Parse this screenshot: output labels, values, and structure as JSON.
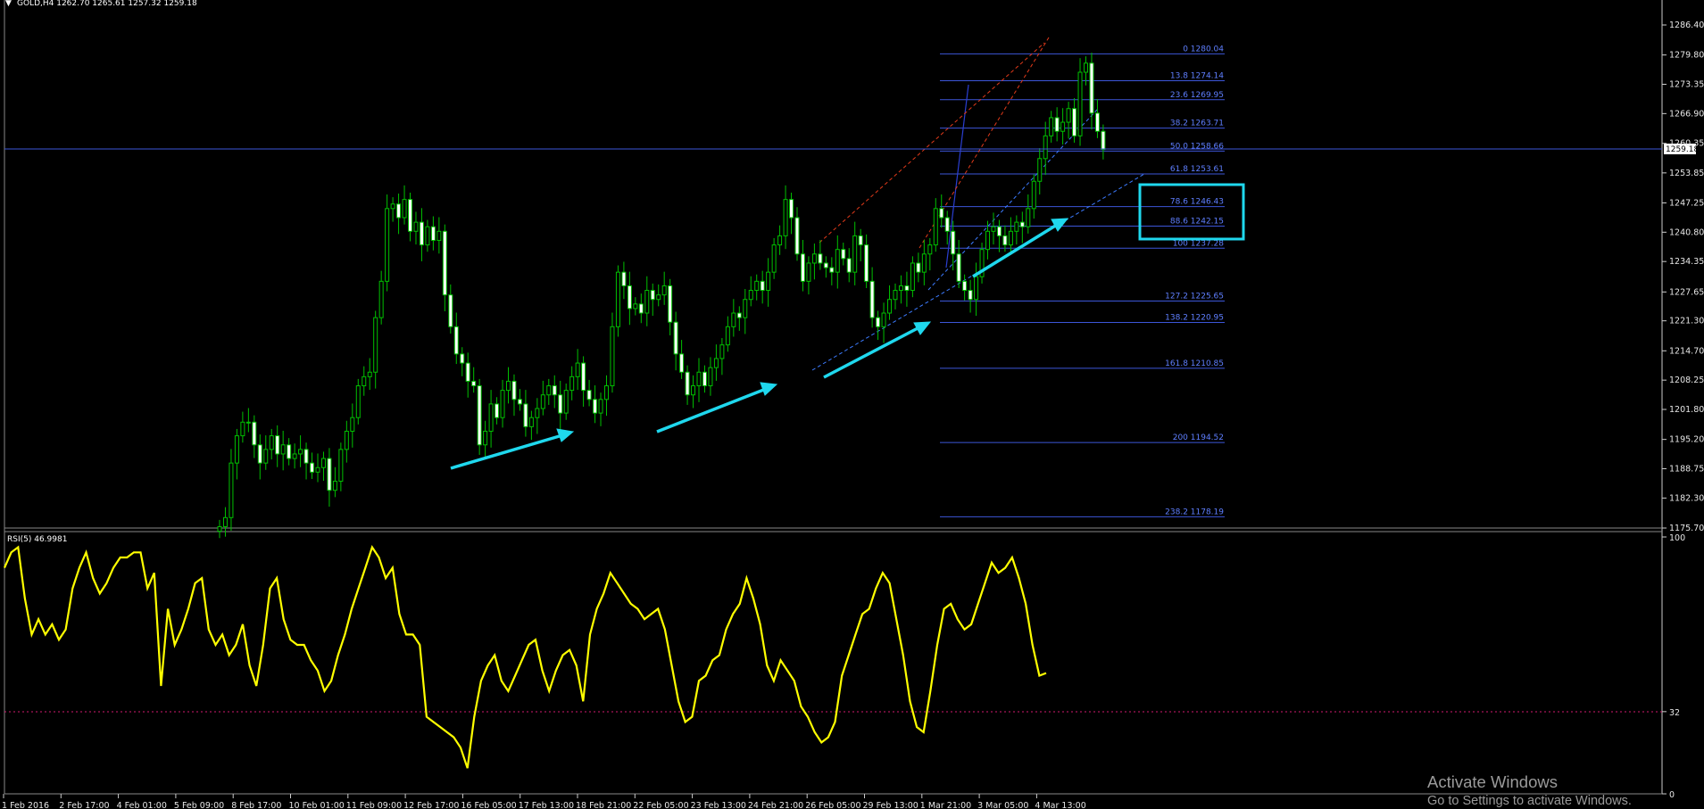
{
  "symbol_header": {
    "marker": "▼",
    "text": "GOLD,H4  1262.70 1265.61 1257.32 1259.18"
  },
  "rsi_header": "RSI(5) 46.9981",
  "current_price_label": "1259.18",
  "price_axis_labels": [
    "1286.40",
    "1279.80",
    "1273.35",
    "1266.90",
    "1260.35",
    "1253.85",
    "1247.25",
    "1240.80",
    "1234.35",
    "1227.65",
    "1221.30",
    "1214.70",
    "1208.25",
    "1201.80",
    "1195.20",
    "1188.75",
    "1182.30",
    "1175.70"
  ],
  "rsi_axis_labels": [
    "100",
    "32",
    "0"
  ],
  "time_axis_labels": [
    "1 Feb 2016",
    "2 Feb 17:00",
    "4 Feb 01:00",
    "5 Feb 09:00",
    "8 Feb 17:00",
    "10 Feb 01:00",
    "11 Feb 09:00",
    "12 Feb 17:00",
    "16 Feb 05:00",
    "17 Feb 13:00",
    "18 Feb 21:00",
    "22 Feb 05:00",
    "23 Feb 13:00",
    "24 Feb 21:00",
    "26 Feb 05:00",
    "29 Feb 13:00",
    "1 Mar 21:00",
    "3 Mar 05:00",
    "4 Mar 13:00"
  ],
  "fib_levels": [
    {
      "label": "0 1280.04",
      "price": 1280.04
    },
    {
      "label": "13.8 1274.14",
      "price": 1274.14
    },
    {
      "label": "23.6 1269.95",
      "price": 1269.95
    },
    {
      "label": "38.2 1263.71",
      "price": 1263.71
    },
    {
      "label": "50.0 1258.66",
      "price": 1258.66
    },
    {
      "label": "61.8 1253.61",
      "price": 1253.61
    },
    {
      "label": "78.6 1246.43",
      "price": 1246.43
    },
    {
      "label": "88.6 1242.15",
      "price": 1242.15
    },
    {
      "label": "100 1237.28",
      "price": 1237.28
    },
    {
      "label": "127.2 1225.65",
      "price": 1225.65
    },
    {
      "label": "138.2 1220.95",
      "price": 1220.95
    },
    {
      "label": "161.8 1210.85",
      "price": 1210.85
    },
    {
      "label": "200 1194.52",
      "price": 1194.52
    },
    {
      "label": "238.2 1178.19",
      "price": 1178.19
    }
  ],
  "watermark": {
    "title": "Activate Windows",
    "subtitle": "Go to Settings to activate Windows."
  },
  "colors": {
    "background": "#000000",
    "candle": "#00c000",
    "candle_bull_body": "#000000",
    "candle_bear_body": "#ffffff",
    "rsi_line": "#ffff00",
    "fib_line": "#3c56d8",
    "arrow": "#1fd8ee",
    "highlight_box": "#1fd8ee",
    "channel_blue": "#3c7bff",
    "channel_red": "#e23a1a",
    "rsi_level_line": "#d11a6e"
  },
  "chart_data": [
    {
      "type": "candlestick",
      "title": "GOLD,H4",
      "ohlc_last": {
        "open": 1262.7,
        "high": 1265.61,
        "low": 1257.32,
        "close": 1259.18
      },
      "ylim": [
        1175.7,
        1286.4
      ],
      "x_range": [
        "1 Feb 2016",
        "4 Mar 2016 13:00"
      ],
      "close": [
        1176,
        1178,
        1190,
        1196,
        1199,
        1199,
        1194,
        1190,
        1193,
        1196,
        1192,
        1194,
        1191,
        1192,
        1193,
        1190,
        1188,
        1189,
        1191,
        1184,
        1186,
        1193,
        1197,
        1200,
        1207,
        1209,
        1210,
        1222,
        1230,
        1246,
        1247,
        1244,
        1248,
        1241,
        1243,
        1238,
        1242,
        1239,
        1241,
        1227,
        1220,
        1214,
        1212,
        1208,
        1207,
        1194,
        1197,
        1203,
        1200,
        1206,
        1208,
        1204,
        1203,
        1198,
        1200,
        1202,
        1205,
        1207,
        1205,
        1201,
        1206,
        1209,
        1212,
        1206,
        1204,
        1201,
        1204,
        1207,
        1220,
        1232,
        1229,
        1224,
        1225,
        1223,
        1228,
        1226,
        1227,
        1229,
        1221,
        1214,
        1210,
        1205,
        1207,
        1210,
        1207,
        1211,
        1213,
        1216,
        1220,
        1223,
        1222,
        1226,
        1228,
        1230,
        1228,
        1232,
        1238,
        1240,
        1248,
        1244,
        1236,
        1230,
        1234,
        1236,
        1234,
        1233,
        1232,
        1237,
        1235,
        1232,
        1240,
        1238,
        1230,
        1222,
        1220,
        1223,
        1226,
        1228,
        1229,
        1228,
        1234,
        1232,
        1236,
        1238,
        1246,
        1244,
        1241,
        1236,
        1230,
        1228,
        1226,
        1231,
        1237,
        1241,
        1242,
        1240,
        1238,
        1241,
        1243,
        1242,
        1246,
        1252,
        1257,
        1262,
        1266,
        1263,
        1265,
        1268,
        1262,
        1276,
        1278,
        1267,
        1263,
        1259
      ]
    },
    {
      "type": "line",
      "title": "RSI(5) 46.9981",
      "ylim": [
        0,
        100
      ],
      "levels": [
        32
      ],
      "series": [
        {
          "name": "RSI(5)",
          "values": [
            88,
            94,
            96,
            76,
            62,
            68,
            62,
            66,
            60,
            64,
            80,
            88,
            94,
            84,
            78,
            82,
            88,
            92,
            92,
            94,
            94,
            80,
            86,
            42,
            72,
            58,
            64,
            72,
            82,
            84,
            64,
            58,
            62,
            54,
            58,
            66,
            50,
            42,
            58,
            80,
            84,
            68,
            60,
            58,
            58,
            52,
            48,
            40,
            44,
            54,
            62,
            72,
            80,
            88,
            96,
            92,
            84,
            88,
            70,
            62,
            62,
            58,
            30,
            28,
            26,
            24,
            22,
            18,
            10,
            30,
            44,
            50,
            54,
            44,
            40,
            46,
            52,
            58,
            60,
            48,
            40,
            48,
            54,
            56,
            50,
            36,
            62,
            72,
            78,
            86,
            82,
            78,
            74,
            72,
            68,
            70,
            72,
            64,
            50,
            36,
            28,
            30,
            44,
            46,
            52,
            54,
            64,
            70,
            74,
            84,
            76,
            66,
            50,
            44,
            52,
            48,
            44,
            34,
            30,
            24,
            20,
            22,
            28,
            46,
            54,
            62,
            70,
            72,
            80,
            86,
            82,
            68,
            54,
            36,
            26,
            24,
            40,
            58,
            72,
            74,
            68,
            64,
            66,
            74,
            82,
            90,
            86,
            88,
            92,
            84,
            74,
            58,
            46,
            47
          ]
        }
      ]
    }
  ]
}
